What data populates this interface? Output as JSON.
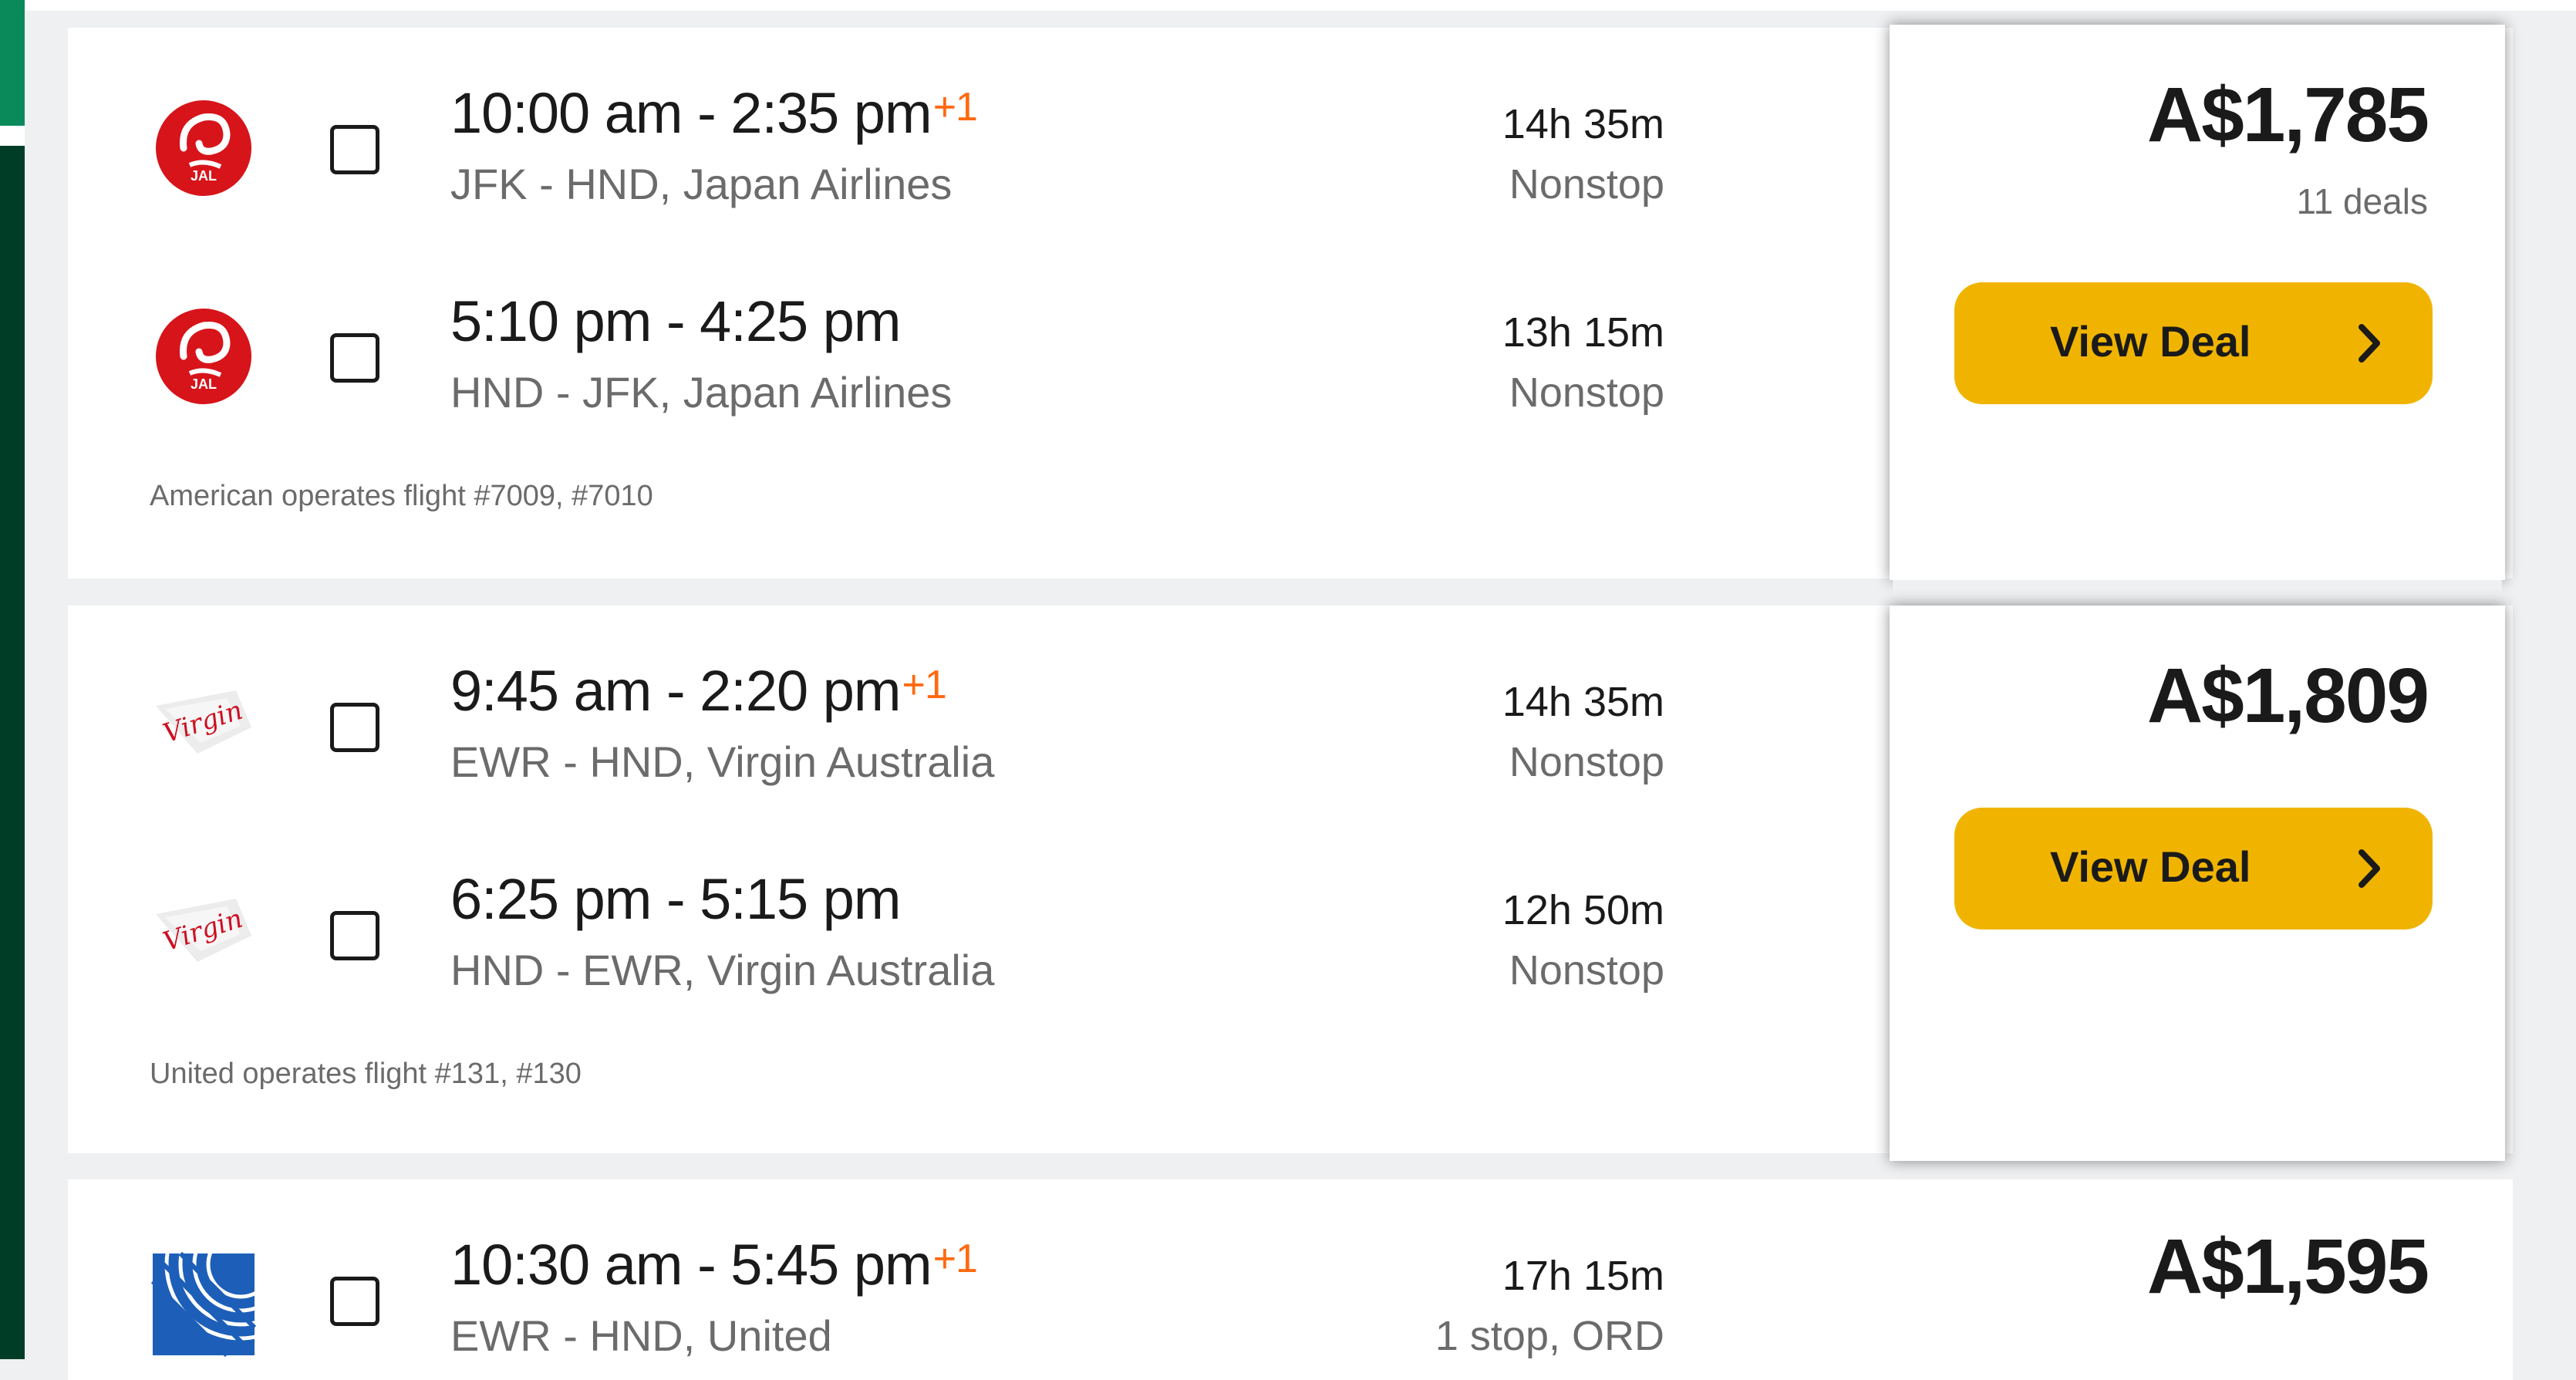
{
  "colors": {
    "accent_green": "#0a8a5b",
    "dark_green": "#003d26",
    "deal_button": "#f0b400",
    "plus_day": "#ff690f"
  },
  "results": [
    {
      "legs": [
        {
          "airline_icon": "jal-logo-icon",
          "times": "10:00 am - 2:35 pm",
          "plus_day": "+1",
          "route": "JFK - HND, Japan Airlines",
          "duration": "14h 35m",
          "stops": "Nonstop"
        },
        {
          "airline_icon": "jal-logo-icon",
          "times": "5:10 pm - 4:25 pm",
          "plus_day": "",
          "route": "HND - JFK, Japan Airlines",
          "duration": "13h 15m",
          "stops": "Nonstop"
        }
      ],
      "operated_by": "American operates flight #7009, #7010",
      "price": "A$1,785",
      "deals": "11 deals",
      "button_label": "View Deal"
    },
    {
      "legs": [
        {
          "airline_icon": "virgin-australia-logo-icon",
          "times": "9:45 am - 2:20 pm",
          "plus_day": "+1",
          "route": "EWR - HND, Virgin Australia",
          "duration": "14h 35m",
          "stops": "Nonstop"
        },
        {
          "airline_icon": "virgin-australia-logo-icon",
          "times": "6:25 pm - 5:15 pm",
          "plus_day": "",
          "route": "HND - EWR, Virgin Australia",
          "duration": "12h 50m",
          "stops": "Nonstop"
        }
      ],
      "operated_by": "United operates flight #131, #130",
      "price": "A$1,809",
      "button_label": "View Deal"
    },
    {
      "legs": [
        {
          "airline_icon": "united-logo-icon",
          "times": "10:30 am - 5:45 pm",
          "plus_day": "+1",
          "route": "EWR - HND, United",
          "duration": "17h 15m",
          "stops": "1 stop, ORD"
        }
      ],
      "price": "A$1,595"
    }
  ]
}
